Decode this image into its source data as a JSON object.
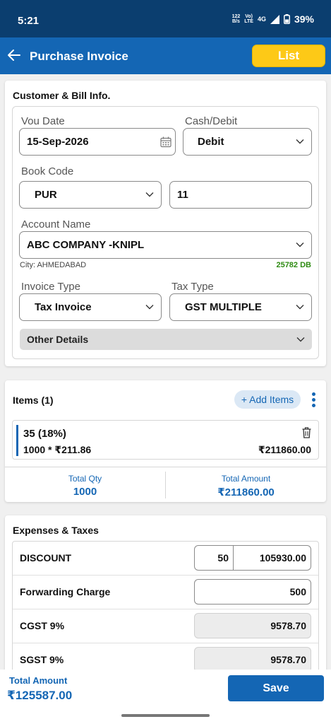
{
  "status_bar": {
    "time": "5:21",
    "speed_value": "122",
    "speed_unit": "B/s",
    "volte_top": "Vo)",
    "volte_bottom": "LTE",
    "network": "4G",
    "battery": "39%"
  },
  "app_bar": {
    "title": "Purchase Invoice",
    "list_button": "List"
  },
  "customer_bill": {
    "section_title": "Customer & Bill Info.",
    "vou_date_label": "Vou Date",
    "vou_date_value": "15-Sep-2026",
    "cash_debit_label": "Cash/Debit",
    "cash_debit_value": "Debit",
    "book_code_label": "Book Code",
    "book_code_value": "PUR",
    "book_number_value": "11",
    "account_name_label": "Account Name",
    "account_name_value": "ABC COMPANY -KNIPL",
    "city_text": "City: AHMEDABAD",
    "balance_text": "25782 DB",
    "invoice_type_label": "Invoice Type",
    "invoice_type_value": "Tax Invoice",
    "tax_type_label": "Tax Type",
    "tax_type_value": "GST MULTIPLE",
    "other_details_label": "Other Details"
  },
  "items": {
    "section_title": "Items (1)",
    "add_items_button": "+ Add Items",
    "rows": [
      {
        "name": "35 (18%)",
        "calc": "1000 * ₹211.86",
        "amount": "₹211860.00"
      }
    ],
    "total_qty_label": "Total Qty",
    "total_qty_value": "1000",
    "total_amount_label": "Total Amount",
    "total_amount_value": "₹211860.00"
  },
  "expenses": {
    "section_title": "Expenses & Taxes",
    "rows": [
      {
        "label": "DISCOUNT",
        "percent": "50",
        "value": "105930.00"
      },
      {
        "label": "Forwarding Charge",
        "value": "500"
      },
      {
        "label": "CGST 9%",
        "value": "9578.70"
      },
      {
        "label": "SGST 9%",
        "value": "9578.70"
      }
    ]
  },
  "footer": {
    "total_amount_label": "Total Amount",
    "total_amount_value": "₹125587.00",
    "save_button": "Save"
  },
  "colors": {
    "status_bar": "#0b3e6f",
    "primary": "#1466b4",
    "list_button": "#fdc917",
    "balance_green": "#2e8b12"
  }
}
